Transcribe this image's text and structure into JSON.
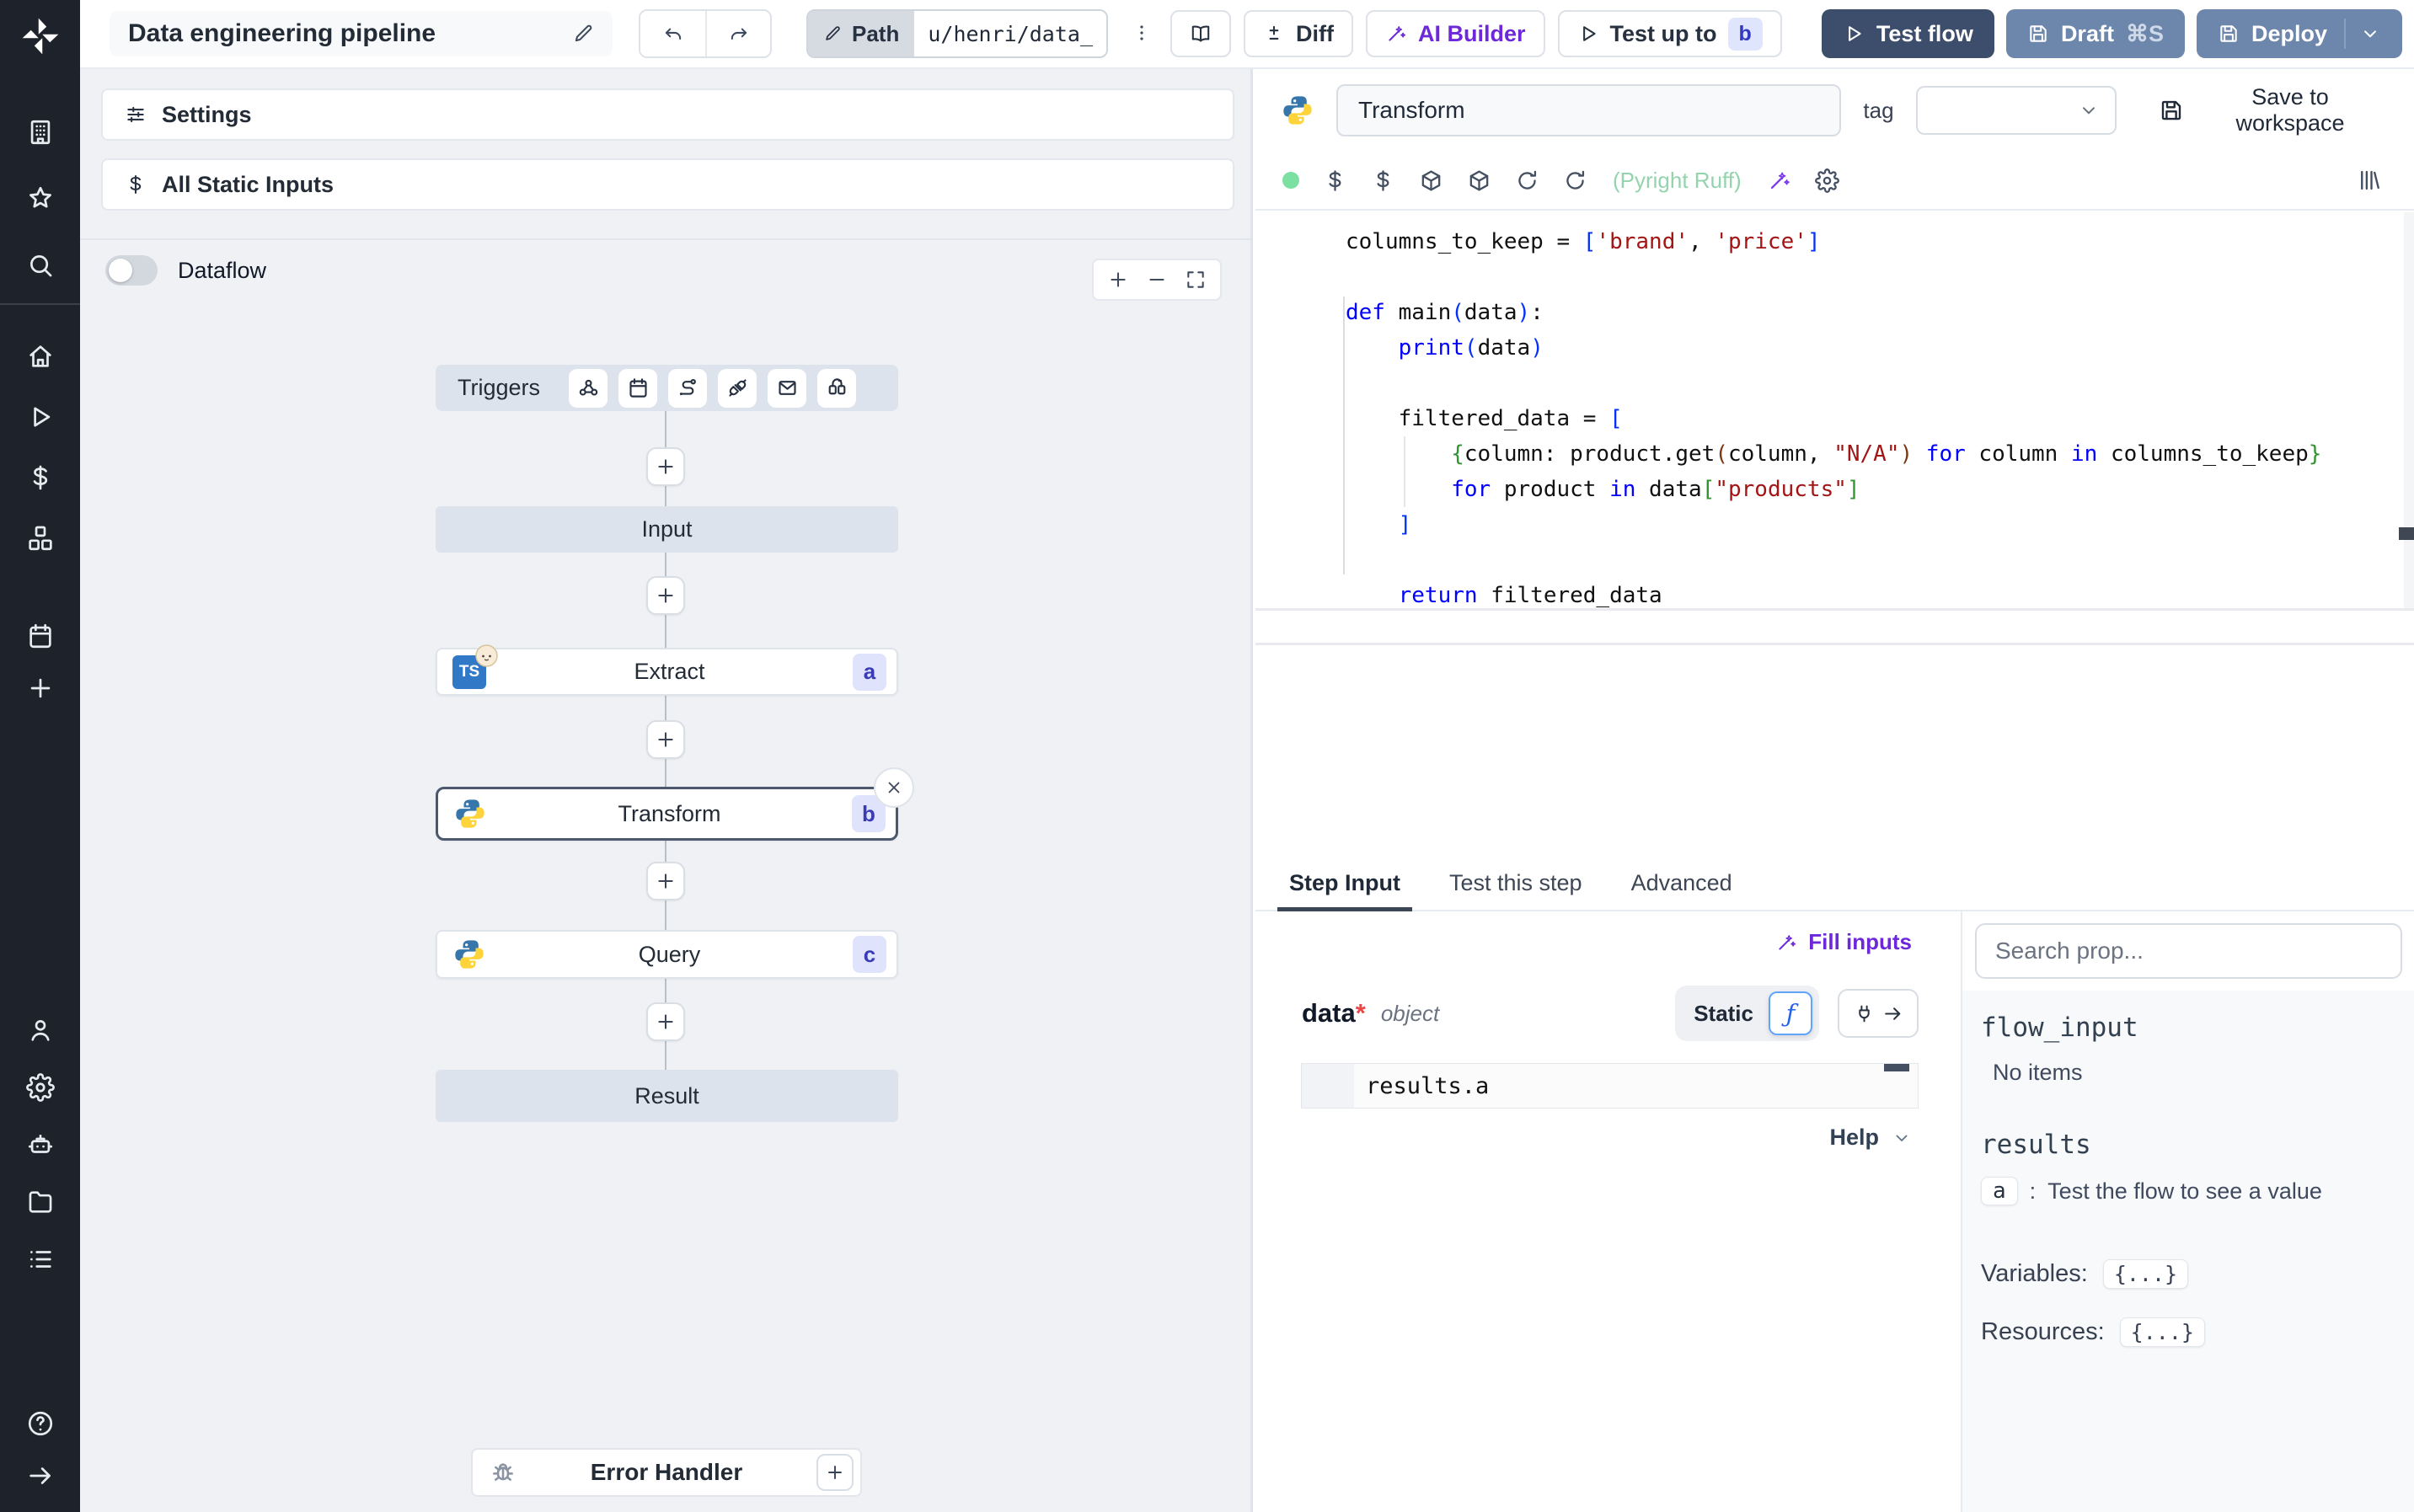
{
  "topbar": {
    "title": "Data engineering pipeline",
    "path_label": "Path",
    "path_value": "u/henri/data_",
    "diff_label": "Diff",
    "ai_builder_label": "AI Builder",
    "test_up_to_label": "Test up to",
    "test_up_to_badge": "b",
    "test_flow_label": "Test flow",
    "draft_label": "Draft",
    "draft_shortcut": "⌘S",
    "deploy_label": "Deploy"
  },
  "sidebar": {
    "top_icons": [
      "building",
      "star",
      "search"
    ],
    "main_icons": [
      "home",
      "play",
      "dollar",
      "cubes"
    ],
    "secondary_icons": [
      "calendar",
      "plus"
    ],
    "lower_icons": [
      "user",
      "gear",
      "robot",
      "folder",
      "list"
    ],
    "bottom_icons": [
      "help",
      "arrow-right"
    ]
  },
  "canvas": {
    "settings_label": "Settings",
    "static_inputs_label": "All Static Inputs",
    "dataflow_label": "Dataflow",
    "triggers_label": "Triggers",
    "trigger_icons": [
      "webhook",
      "calendar",
      "route",
      "plug",
      "mail",
      "poll"
    ],
    "input_label": "Input",
    "result_label": "Result",
    "error_handler_label": "Error Handler",
    "steps": [
      {
        "label": "Extract",
        "badge": "a",
        "language": "typescript-bun"
      },
      {
        "label": "Transform",
        "badge": "b",
        "language": "python",
        "selected": true
      },
      {
        "label": "Query",
        "badge": "c",
        "language": "python"
      }
    ]
  },
  "editor": {
    "step_name": "Transform",
    "tag_label": "tag",
    "tag_value": "",
    "save_label": "Save to workspace",
    "lint_label": "(Pyright Ruff)",
    "toolbar_left_icons": [
      "dollar",
      "dollar",
      "package",
      "package",
      "refresh",
      "refresh"
    ],
    "toolbar_right_icons": [
      "wand",
      "gear"
    ],
    "code_lines": [
      [
        {
          "t": "columns_to_keep = ",
          "c": "pl"
        },
        {
          "t": "[",
          "c": "b1"
        },
        {
          "t": "'brand'",
          "c": "str"
        },
        {
          "t": ", ",
          "c": "pl"
        },
        {
          "t": "'price'",
          "c": "str"
        },
        {
          "t": "]",
          "c": "b1"
        }
      ],
      [],
      [
        {
          "t": "def",
          "c": "kw"
        },
        {
          "t": " main",
          "c": "pl"
        },
        {
          "t": "(",
          "c": "b1"
        },
        {
          "t": "data",
          "c": "pl"
        },
        {
          "t": ")",
          "c": "b1"
        },
        {
          "t": ":",
          "c": "pl"
        }
      ],
      [
        {
          "t": "    ",
          "c": "pl"
        },
        {
          "t": "print",
          "c": "kw"
        },
        {
          "t": "(",
          "c": "b1"
        },
        {
          "t": "data",
          "c": "pl"
        },
        {
          "t": ")",
          "c": "b1"
        }
      ],
      [],
      [
        {
          "t": "    filtered_data = ",
          "c": "pl"
        },
        {
          "t": "[",
          "c": "b1"
        }
      ],
      [
        {
          "t": "        ",
          "c": "pl"
        },
        {
          "t": "{",
          "c": "b2"
        },
        {
          "t": "column: product.get",
          "c": "pl"
        },
        {
          "t": "(",
          "c": "b3"
        },
        {
          "t": "column, ",
          "c": "pl"
        },
        {
          "t": "\"N/A\"",
          "c": "str"
        },
        {
          "t": ")",
          "c": "b3"
        },
        {
          "t": " ",
          "c": "pl"
        },
        {
          "t": "for",
          "c": "kw"
        },
        {
          "t": " column ",
          "c": "pl"
        },
        {
          "t": "in",
          "c": "kw"
        },
        {
          "t": " columns_to_keep",
          "c": "pl"
        },
        {
          "t": "}",
          "c": "b2"
        }
      ],
      [
        {
          "t": "        ",
          "c": "pl"
        },
        {
          "t": "for",
          "c": "kw"
        },
        {
          "t": " product ",
          "c": "pl"
        },
        {
          "t": "in",
          "c": "kw"
        },
        {
          "t": " data",
          "c": "pl"
        },
        {
          "t": "[",
          "c": "b2"
        },
        {
          "t": "\"products\"",
          "c": "str"
        },
        {
          "t": "]",
          "c": "b2"
        }
      ],
      [
        {
          "t": "    ",
          "c": "pl"
        },
        {
          "t": "]",
          "c": "b1"
        }
      ],
      [],
      [
        {
          "t": "    ",
          "c": "pl"
        },
        {
          "t": "return",
          "c": "kw"
        },
        {
          "t": " filtered_data",
          "c": "pl"
        }
      ]
    ]
  },
  "bottom": {
    "tabs": [
      "Step Input",
      "Test this step",
      "Advanced"
    ],
    "active_tab": "Step Input",
    "fill_inputs_label": "Fill inputs",
    "arg_name": "data",
    "arg_required": "*",
    "arg_type": "object",
    "static_label": "Static",
    "expr_value": "results.a",
    "help_label": "Help"
  },
  "props": {
    "search_placeholder": "Search prop...",
    "flow_input_label": "flow_input",
    "flow_input_empty": "No items",
    "results_label": "results",
    "result_key": "a",
    "result_hint": "Test the flow to see a value",
    "variables_label": "Variables:",
    "variables_value": "{...}",
    "resources_label": "Resources:",
    "resources_value": "{...}"
  },
  "colors": {
    "accent_purple": "#6d28d9",
    "primary_button": "#3d4e6c",
    "secondary_button": "#6d86ac",
    "badge_bg": "#dfe3fc",
    "badge_text": "#3b3bb3",
    "lint_green": "#93d4ad",
    "status_dot_green": "#7ce0a3",
    "sidebar_bg": "#1e222a",
    "canvas_bg": "#eff1f5",
    "node_io_bg": "#dce3ed",
    "code_keyword": "#0000ff",
    "code_string": "#a31515",
    "code_bracket_1": "#0431fa",
    "code_bracket_2": "#319331",
    "code_bracket_3": "#7b3814"
  }
}
